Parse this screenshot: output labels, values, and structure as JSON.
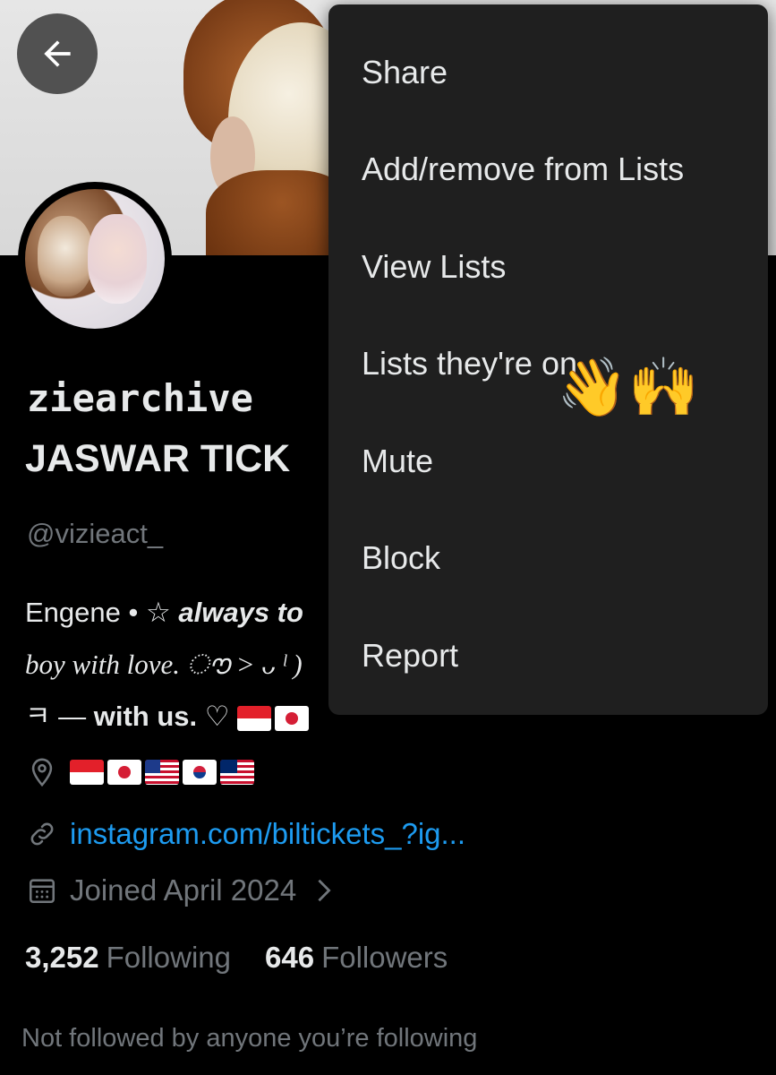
{
  "menu": {
    "items": [
      {
        "label": "Share"
      },
      {
        "label": "Add/remove from Lists"
      },
      {
        "label": "View Lists"
      },
      {
        "label": "Lists they're on"
      },
      {
        "label": "Mute"
      },
      {
        "label": "Block"
      },
      {
        "label": "Report"
      }
    ],
    "decoration_emoji": "👋🙌"
  },
  "profile": {
    "display_name_line1": "ziearchive",
    "display_name_line2": "JASWAR TICK",
    "handle": "@vizieact_",
    "bio": {
      "line1_prefix": "Engene • ☆ ",
      "line1_bold_italic": "always to",
      "line2": "boy with love. ൗ > ᴗ ˡ )",
      "line3_prefix": "ㅋ — ",
      "line3_bold": "with us.",
      "line3_suffix": " ♡"
    },
    "location_flags": [
      "id",
      "jp",
      "us",
      "kr",
      "my"
    ],
    "link": "instagram.com/biltickets_?ig...",
    "joined": "Joined April 2024"
  },
  "stats": {
    "following_count": "3,252",
    "following_label": "Following",
    "followers_count": "646",
    "followers_label": "Followers"
  },
  "footer": {
    "not_followed": "Not followed by anyone you’re following"
  },
  "colors": {
    "background": "#000000",
    "menu_bg": "#1f1f1f",
    "text_primary": "#e7e9ea",
    "text_secondary": "#71767b",
    "link": "#1d9bf0"
  }
}
